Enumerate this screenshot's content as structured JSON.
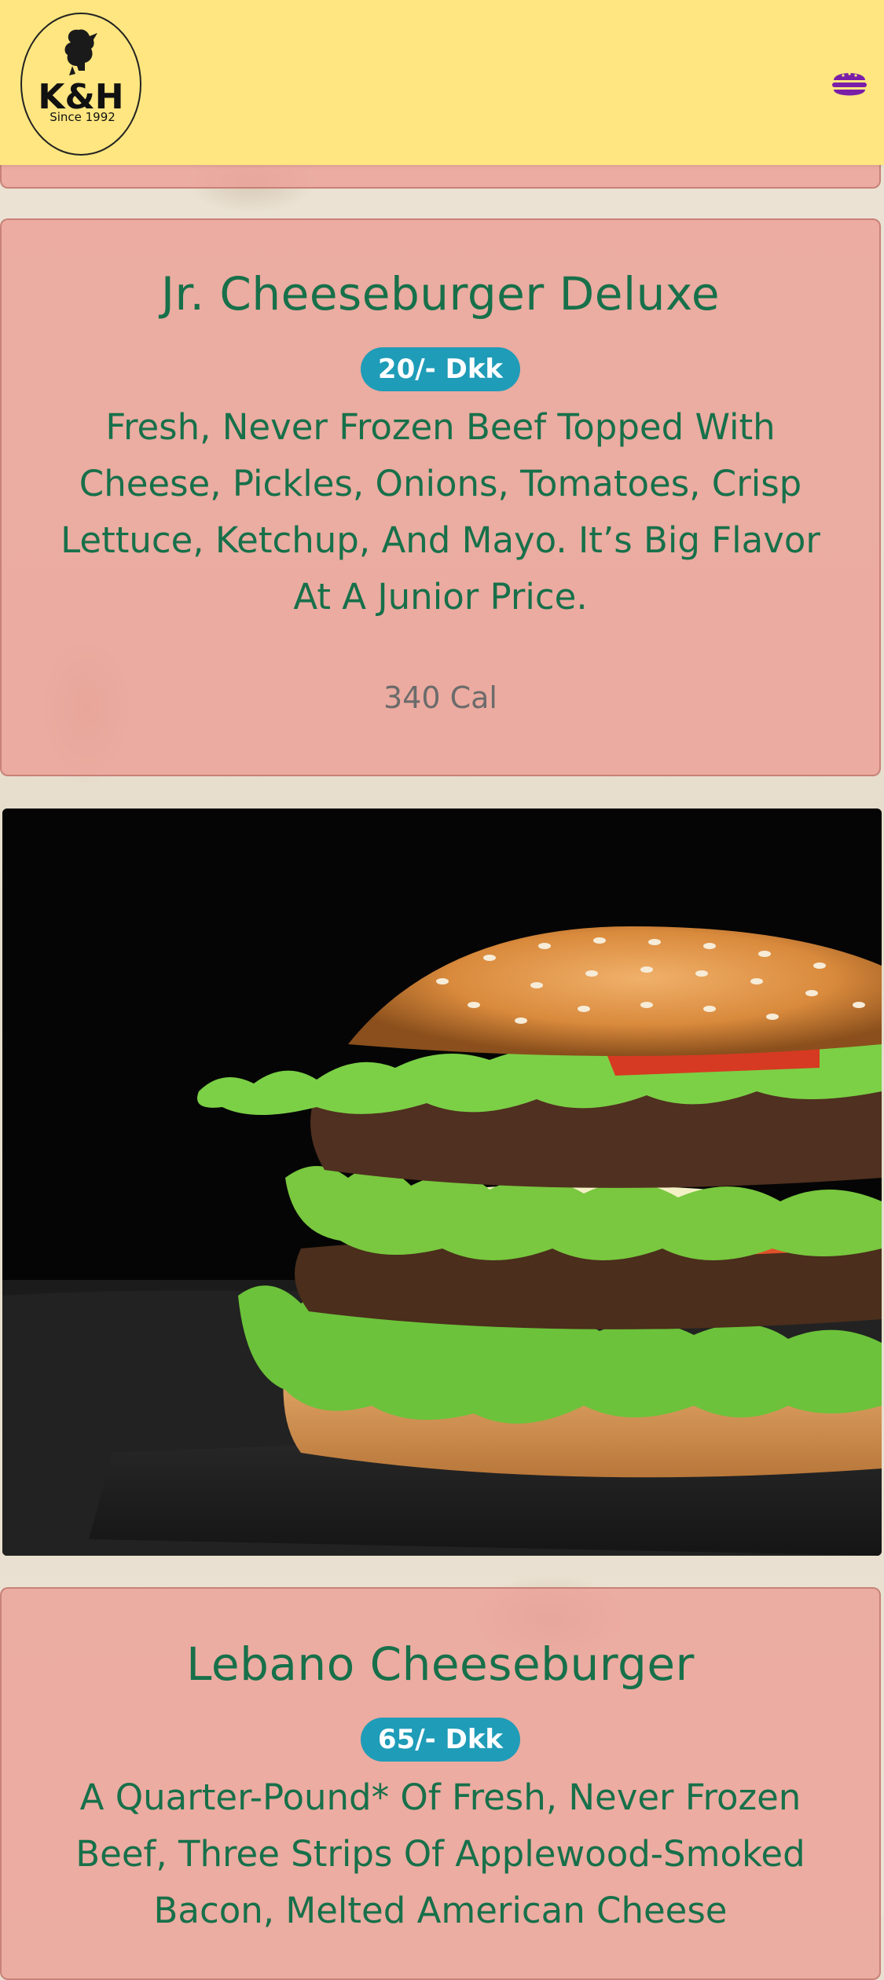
{
  "header": {
    "logo_text": "K&H",
    "logo_tagline": "Since 1992",
    "menu_icon": "burger-menu-icon"
  },
  "colors": {
    "header_bg": "#ffe680",
    "card_bg": "#eba096",
    "title_color": "#17704a",
    "badge_bg": "#1f9cb8",
    "menu_icon_color": "#7a1ea8"
  },
  "menu_items": [
    {
      "name": "Jr. Cheeseburger Deluxe",
      "price": "20/- Dkk",
      "description": "Fresh, Never Frozen Beef Topped With Cheese, Pickles, Onions, Tomatoes, Crisp Lettuce, Ketchup, And Mayo. It’s Big Flavor At A Junior Price.",
      "calories": "340 Cal"
    },
    {
      "name": "Lebano Cheeseburger",
      "price": "65/- Dkk",
      "description": "A Quarter-Pound* Of Fresh, Never Frozen Beef, Three Strips Of Applewood-Smoked Bacon, Melted American Cheese",
      "calories": ""
    }
  ],
  "image": {
    "subject": "double-cheeseburger-photo"
  }
}
